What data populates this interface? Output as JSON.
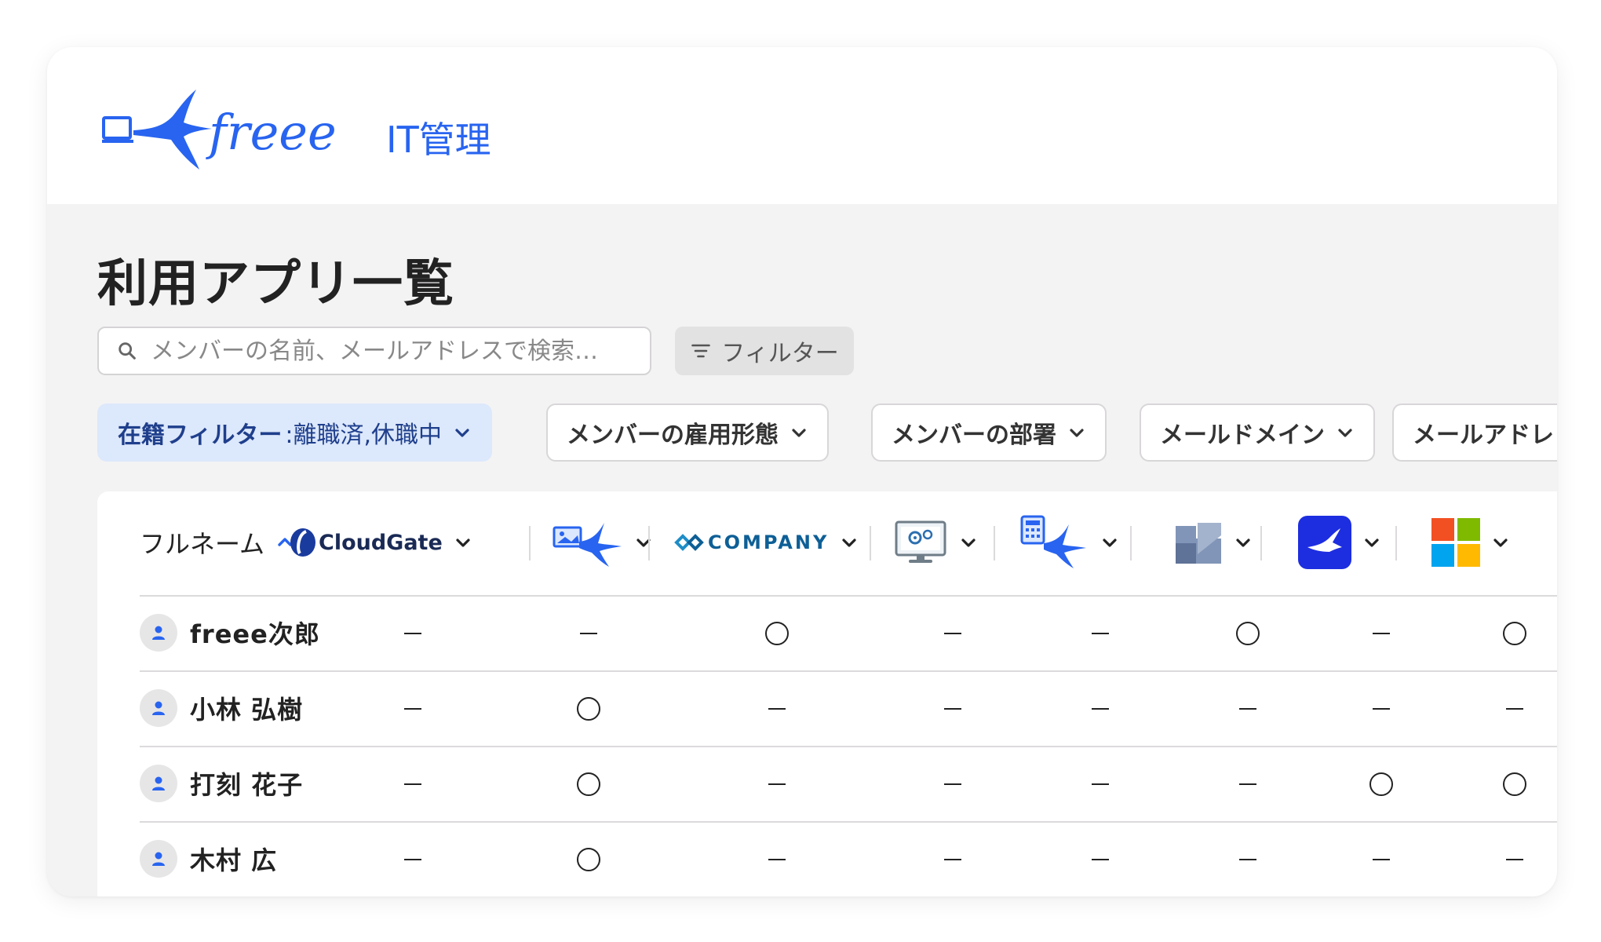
{
  "brand": {
    "wordmark": "freee",
    "product": "IT管理",
    "color": "#2864f0"
  },
  "page": {
    "title": "利用アプリ一覧"
  },
  "search": {
    "placeholder": "メンバーの名前、メールアドレスで検索…",
    "icon": "search-icon"
  },
  "filter_button": {
    "label": "フィルター",
    "icon": "filter-icon"
  },
  "chips": [
    {
      "label": "在籍フィルター",
      "value": ":離職済,休職中",
      "active": true
    },
    {
      "label": "メンバーの雇用形態",
      "active": false
    },
    {
      "label": "メンバーの部署",
      "active": false
    },
    {
      "label": "メールドメイン",
      "active": false
    },
    {
      "label": "メールアドレ",
      "active": false
    }
  ],
  "table": {
    "name_header": "フルネーム",
    "sort_icon": "chevron-up-icon",
    "apps": [
      {
        "name": "CloudGate",
        "icon": "cloudgate-logo"
      },
      {
        "name": "freee app (photo)",
        "icon": "freee-photo-app-icon"
      },
      {
        "name": "COMPANY",
        "icon": "company-logo"
      },
      {
        "name": "monitor settings",
        "icon": "monitor-gear-icon"
      },
      {
        "name": "freee app (calculator)",
        "icon": "freee-calculator-app-icon"
      },
      {
        "name": "slate app",
        "icon": "slate-app-icon"
      },
      {
        "name": "blue bird app",
        "icon": "blue-bird-app-icon"
      },
      {
        "name": "Microsoft",
        "icon": "microsoft-logo"
      }
    ],
    "marks": {
      "used": "○",
      "unused": "–"
    },
    "rows": [
      {
        "name": "freee次郎",
        "cells": [
          "-",
          "-",
          "o",
          "-",
          "-",
          "o",
          "-",
          "o"
        ]
      },
      {
        "name": "小林 弘樹",
        "cells": [
          "-",
          "o",
          "-",
          "-",
          "-",
          "-",
          "-",
          "-"
        ]
      },
      {
        "name": "打刻 花子",
        "cells": [
          "-",
          "o",
          "-",
          "-",
          "-",
          "-",
          "o",
          "o"
        ]
      },
      {
        "name": "木村 広",
        "cells": [
          "-",
          "o",
          "-",
          "-",
          "-",
          "-",
          "-",
          "-"
        ]
      }
    ]
  },
  "colors": {
    "accent": "#2864f0",
    "chip_active_bg": "#dce8fb",
    "chip_active_text": "#1f3f8c",
    "ms_red": "#f25022",
    "ms_green": "#7fba00",
    "ms_blue": "#00a4ef",
    "ms_yellow": "#ffb900"
  }
}
